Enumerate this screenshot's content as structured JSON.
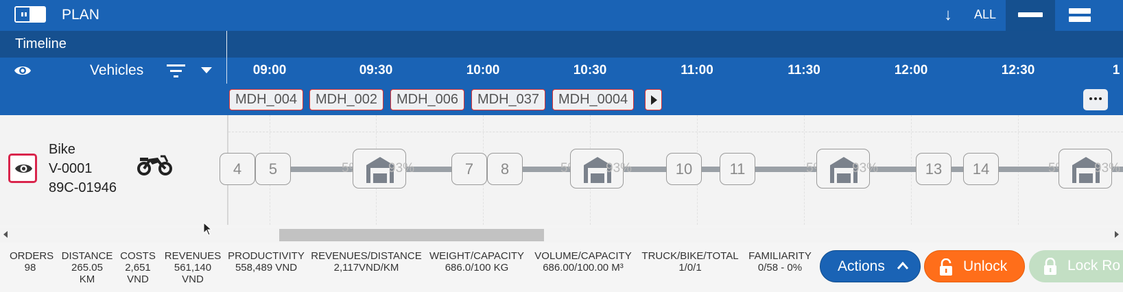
{
  "topbar": {
    "title": "PLAN",
    "filter_label": "ALL"
  },
  "timeline": {
    "label": "Timeline"
  },
  "header": {
    "vehicles_label": "Vehicles",
    "ticks": [
      "09:00",
      "09:30",
      "10:00",
      "10:30",
      "11:00",
      "11:30",
      "12:00",
      "12:30",
      "1"
    ]
  },
  "tags": [
    "MDH_004",
    "MDH_002",
    "MDH_006",
    "MDH_037",
    "MDH_0004"
  ],
  "vehicle": {
    "name": "Bike",
    "id": "V-0001",
    "plate": "89C-01946"
  },
  "route": {
    "stops": [
      "4",
      "5",
      "7",
      "8",
      "10",
      "11",
      "13",
      "14"
    ],
    "depot_labels": [
      {
        "left": "5%",
        "right": "93%"
      },
      {
        "left": "5%",
        "right": "93%"
      },
      {
        "left": "5%",
        "right": "93%"
      },
      {
        "left": "5%",
        "right": "93%"
      }
    ]
  },
  "stats": [
    {
      "label": "ORDERS",
      "value": "98",
      "value2": ""
    },
    {
      "label": "DISTANCE",
      "value": "265.05",
      "value2": "KM"
    },
    {
      "label": "COSTS",
      "value": "2,651",
      "value2": "VND"
    },
    {
      "label": "REVENUES",
      "value": "561,140",
      "value2": "VND"
    },
    {
      "label": "PRODUCTIVITY",
      "value": "558,489 VND",
      "value2": ""
    },
    {
      "label": "REVENUES/DISTANCE",
      "value": "2,117VND/KM",
      "value2": ""
    },
    {
      "label": "WEIGHT/CAPACITY",
      "value": "686.0/100 KG",
      "value2": ""
    },
    {
      "label": "VOLUME/CAPACITY",
      "value": "686.00/100.00 M³",
      "value2": ""
    },
    {
      "label": "TRUCK/BIKE/TOTAL",
      "value": "1/0/1",
      "value2": ""
    },
    {
      "label": "FAMILIARITY",
      "value": "0/58 - 0%",
      "value2": ""
    }
  ],
  "buttons": {
    "actions": "Actions",
    "unlock": "Unlock",
    "lock": "Lock Ro"
  },
  "colors": {
    "primary": "#1a63b5",
    "dark": "#16508f",
    "unlock": "#ff6e1a",
    "lock": "#c3dfc4",
    "highlight": "#d9254c"
  }
}
